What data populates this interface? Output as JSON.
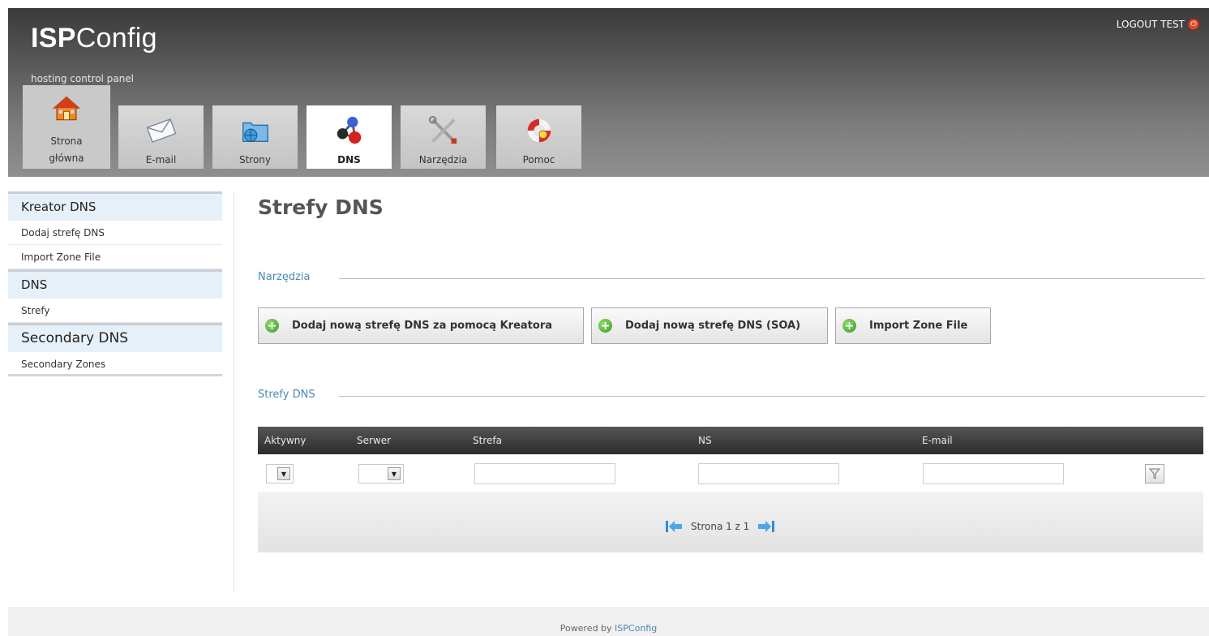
{
  "header": {
    "logo_bold": "ISP",
    "logo_light": "Config",
    "tagline": "hosting control panel",
    "logout": "LOGOUT TEST"
  },
  "tabs": [
    {
      "label_line1": "Strona",
      "label_line2": "główna",
      "icon": "house-icon"
    },
    {
      "label": "E-mail",
      "icon": "envelope-icon"
    },
    {
      "label": "Strony",
      "icon": "folder-globe-icon"
    },
    {
      "label": "DNS",
      "icon": "network-nodes-icon",
      "active": true
    },
    {
      "label": "Narzędzia",
      "icon": "tools-icon"
    },
    {
      "label": "Pomoc",
      "icon": "lifebuoy-icon"
    }
  ],
  "sidebar": {
    "sections": [
      {
        "title": "Kreator DNS",
        "items": [
          "Dodaj strefę DNS",
          "Import Zone File"
        ]
      },
      {
        "title": "DNS",
        "items": [
          "Strefy"
        ]
      },
      {
        "title": "Secondary DNS",
        "items": [
          "Secondary Zones"
        ]
      }
    ]
  },
  "main": {
    "title": "Strefy DNS",
    "tools_legend": "Narzędzia",
    "buttons": [
      "Dodaj nową strefę DNS za pomocą Kreatora",
      "Dodaj nową strefę DNS (SOA)",
      "Import Zone File"
    ],
    "zones_legend": "Strefy DNS",
    "table": {
      "columns": [
        "Aktywny",
        "Serwer",
        "Strefa",
        "NS",
        "E-mail"
      ],
      "filters": {
        "strefa": "",
        "ns": "",
        "email": ""
      }
    },
    "pager": "Strona 1 z 1"
  },
  "footer": {
    "text": "Powered by",
    "link": "ISPConfig"
  },
  "colors": {
    "accent": "#4a8ab5",
    "sidebar_head_bg": "#e6f0f8",
    "table_head_bg": "#2c2c2c",
    "add_icon": "#3c9a22"
  }
}
